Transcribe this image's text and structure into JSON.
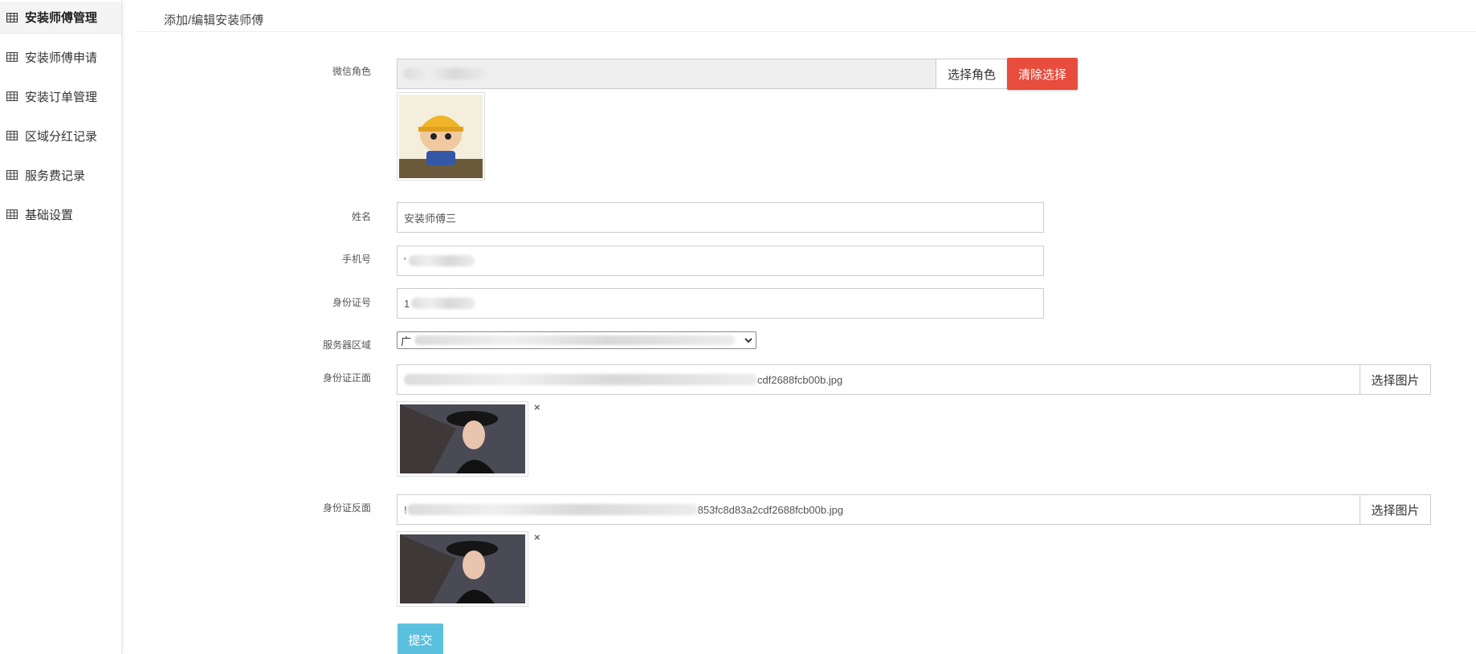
{
  "sidebar": {
    "items": [
      {
        "label": "安装师傅管理",
        "active": true
      },
      {
        "label": "安装师傅申请"
      },
      {
        "label": "安装订单管理"
      },
      {
        "label": "区域分红记录"
      },
      {
        "label": "服务费记录"
      },
      {
        "label": "基础设置"
      }
    ]
  },
  "page": {
    "title": "添加/编辑安装师傅"
  },
  "form": {
    "wechat_role": {
      "label": "微信角色",
      "select_button": "选择角色",
      "clear_button": "清除选择",
      "avatar_icon": "cartoon-worker-avatar"
    },
    "name": {
      "label": "姓名",
      "value": "安装师傅三"
    },
    "phone": {
      "label": "手机号",
      "value": "'"
    },
    "id_number": {
      "label": "身份证号",
      "value": "1"
    },
    "service_area": {
      "label": "服务器区域",
      "value": "广"
    },
    "id_front": {
      "label": "身份证正面",
      "value_suffix": "cdf2688fcb00b.jpg",
      "select_button": "选择图片",
      "remove": "×",
      "photo_icon": "woman-in-hat-photo"
    },
    "id_back": {
      "label": "身份证反面",
      "value_prefix": "!",
      "value_suffix": "853fc8d83a2cdf2688fcb00b.jpg",
      "select_button": "选择图片",
      "remove": "×",
      "photo_icon": "woman-in-hat-photo"
    },
    "submit_button": "提交"
  },
  "colors": {
    "danger": "#e74c3c",
    "info": "#5bc0de",
    "disabled_bg": "#eeeeee"
  }
}
